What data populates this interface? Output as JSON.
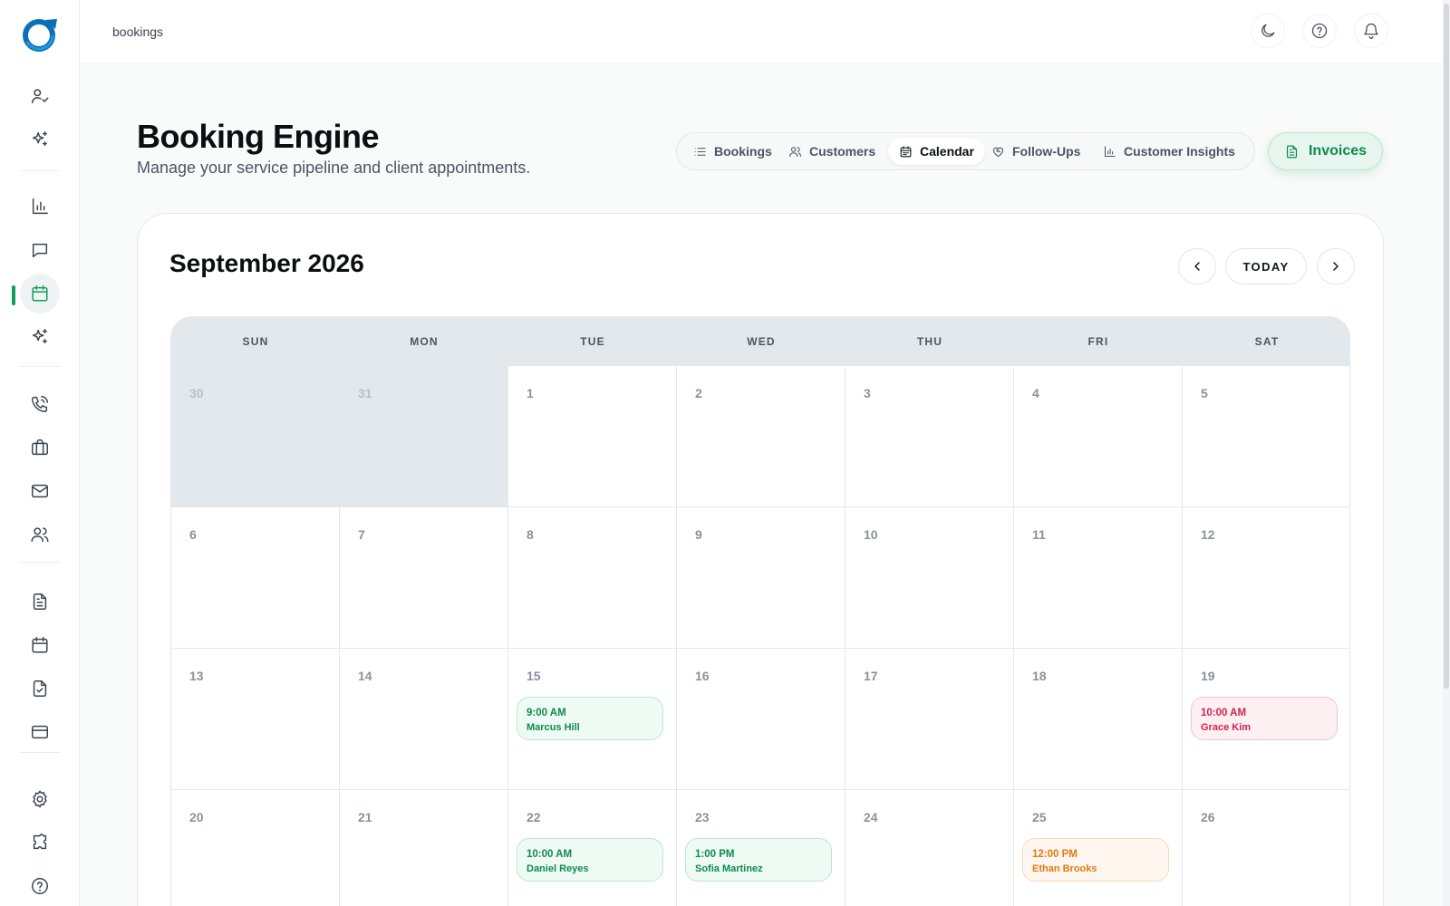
{
  "app": {
    "breadcrumb": "bookings",
    "accent_color": "#0f9d58"
  },
  "sidebar": {
    "items": [
      {
        "icon": "user-check-icon",
        "active": false
      },
      {
        "icon": "sparkles-icon",
        "active": false
      },
      {
        "icon": "bar-chart-icon",
        "active": false
      },
      {
        "icon": "message-square-icon",
        "active": false
      },
      {
        "icon": "calendar-icon",
        "active": true
      },
      {
        "icon": "sparkles-icon",
        "active": false
      },
      {
        "icon": "phone-icon",
        "active": false
      },
      {
        "icon": "briefcase-icon",
        "active": false
      },
      {
        "icon": "mail-icon",
        "active": false
      },
      {
        "icon": "users-icon",
        "active": false
      },
      {
        "icon": "file-text-icon",
        "active": false
      },
      {
        "icon": "calendar-icon",
        "active": false
      },
      {
        "icon": "file-check-icon",
        "active": false
      },
      {
        "icon": "credit-card-icon",
        "active": false
      },
      {
        "icon": "settings-icon",
        "active": false
      },
      {
        "icon": "puzzle-icon",
        "active": false
      },
      {
        "icon": "help-circle-icon",
        "active": false
      }
    ]
  },
  "topbar": {
    "icons": [
      "moon-icon",
      "help-circle-icon",
      "bell-icon"
    ]
  },
  "header": {
    "title": "Booking Engine",
    "subtitle": "Manage your service pipeline and client appointments.",
    "tabs": [
      {
        "label": "Bookings",
        "icon": "list-icon",
        "active": false
      },
      {
        "label": "Customers",
        "icon": "users-icon",
        "active": false
      },
      {
        "label": "Calendar",
        "icon": "calendar-icon",
        "active": true
      },
      {
        "label": "Follow-Ups",
        "icon": "heart-handshake-icon",
        "active": false
      },
      {
        "label": "Customer Insights",
        "icon": "bar-chart-icon",
        "active": false
      }
    ],
    "invoices_label": "Invoices"
  },
  "calendar": {
    "month_label": "September 2026",
    "today_label": "TODAY",
    "weekdays": [
      "SUN",
      "MON",
      "TUE",
      "WED",
      "THU",
      "FRI",
      "SAT"
    ],
    "weeks": [
      [
        {
          "day": "30",
          "other_month": true
        },
        {
          "day": "31",
          "other_month": true
        },
        {
          "day": "1"
        },
        {
          "day": "2"
        },
        {
          "day": "3"
        },
        {
          "day": "4"
        },
        {
          "day": "5"
        }
      ],
      [
        {
          "day": "6"
        },
        {
          "day": "7"
        },
        {
          "day": "8"
        },
        {
          "day": "9"
        },
        {
          "day": "10"
        },
        {
          "day": "11"
        },
        {
          "day": "12"
        }
      ],
      [
        {
          "day": "13"
        },
        {
          "day": "14"
        },
        {
          "day": "15",
          "event": {
            "time": "9:00 AM",
            "name": "Marcus Hill",
            "color": "green"
          }
        },
        {
          "day": "16"
        },
        {
          "day": "17"
        },
        {
          "day": "18"
        },
        {
          "day": "19",
          "event": {
            "time": "10:00 AM",
            "name": "Grace Kim",
            "color": "pink"
          }
        }
      ],
      [
        {
          "day": "20"
        },
        {
          "day": "21"
        },
        {
          "day": "22",
          "event": {
            "time": "10:00 AM",
            "name": "Daniel Reyes",
            "color": "green"
          }
        },
        {
          "day": "23",
          "event": {
            "time": "1:00 PM",
            "name": "Sofia Martinez",
            "color": "green"
          }
        },
        {
          "day": "24"
        },
        {
          "day": "25",
          "event": {
            "time": "12:00 PM",
            "name": "Ethan Brooks",
            "color": "orange"
          }
        },
        {
          "day": "26"
        }
      ]
    ]
  }
}
